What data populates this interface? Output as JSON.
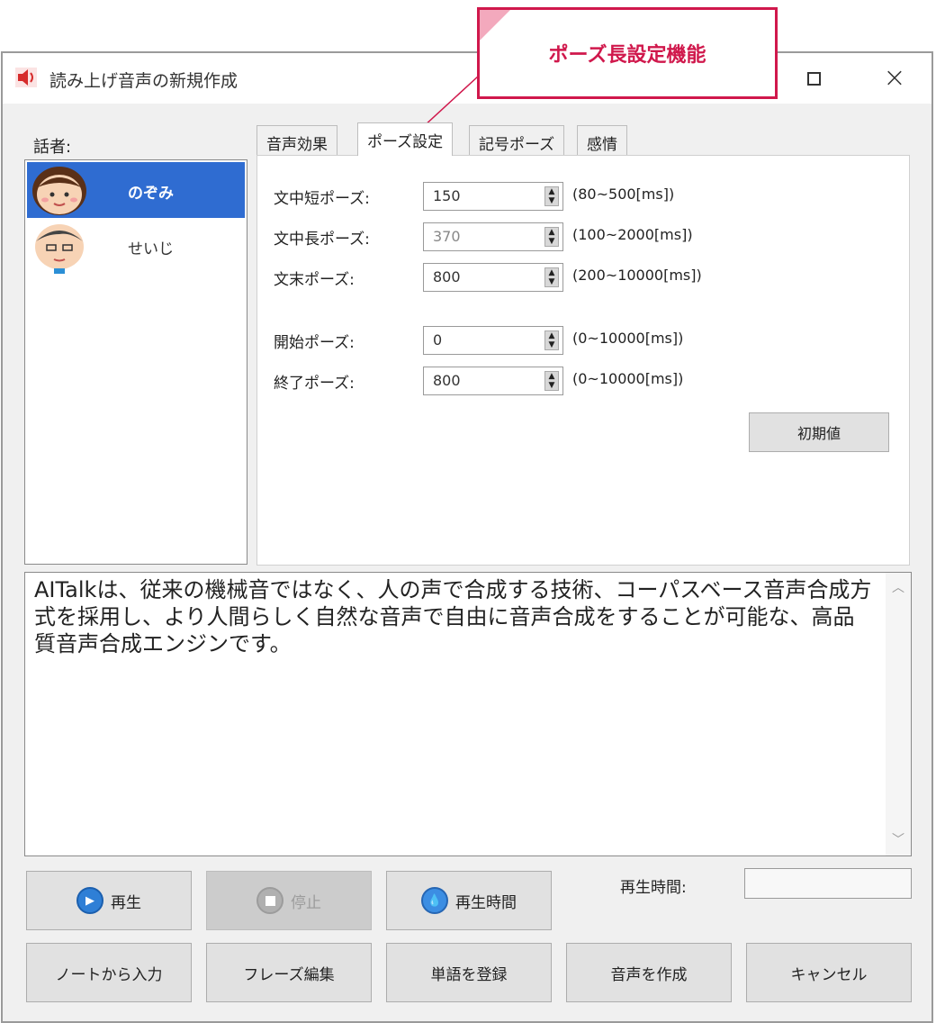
{
  "window": {
    "title": "読み上げ音声の新規作成",
    "maximize_glyph": "",
    "close_glyph": "×"
  },
  "callout": {
    "text": "ポーズ長設定機能"
  },
  "speakers": {
    "label": "話者:",
    "items": [
      {
        "name": "のぞみ",
        "selected": true
      },
      {
        "name": "せいじ",
        "selected": false
      }
    ]
  },
  "tabs": [
    {
      "label": "音声効果",
      "active": false
    },
    {
      "label": "ポーズ設定",
      "active": true
    },
    {
      "label": "記号ポーズ",
      "active": false
    },
    {
      "label": "感情",
      "active": false
    }
  ],
  "pause_settings": {
    "rows": [
      {
        "label": "文中短ポーズ:",
        "value": "150",
        "range": "(80~500[ms])"
      },
      {
        "label": "文中長ポーズ:",
        "value": "370",
        "range": "(100~2000[ms])"
      },
      {
        "label": "文末ポーズ:",
        "value": "800",
        "range": "(200~10000[ms])"
      },
      {
        "label": "開始ポーズ:",
        "value": "0",
        "range": "(0~10000[ms])"
      },
      {
        "label": "終了ポーズ:",
        "value": "800",
        "range": "(0~10000[ms])"
      }
    ],
    "default_button": "初期値"
  },
  "text_area": {
    "content": "AITalkは、従来の機械音ではなく、人の声で合成する技術、コーパスベース音声合成方式を採用し、より人間らしく自然な音声で自由に音声合成をすることが可能な、高品質音声合成エンジンです。"
  },
  "buttons": {
    "play": "再生",
    "stop": "停止",
    "play_time": "再生時間",
    "play_time_label": "再生時間:",
    "play_time_value": "",
    "input_from_notes": "ノートから入力",
    "phrase_edit": "フレーズ編集",
    "register_word": "単語を登録",
    "create_audio": "音声を作成",
    "cancel": "キャンセル"
  },
  "colors": {
    "selected_speaker": "#2f6cd1",
    "callout_accent": "#d0184c"
  },
  "icons": [
    "speaker-icon",
    "maximize-icon",
    "close-icon",
    "play-icon",
    "stop-icon",
    "timer-icon",
    "spin-arrows-icon",
    "scroll-up-icon",
    "scroll-down-icon"
  ]
}
